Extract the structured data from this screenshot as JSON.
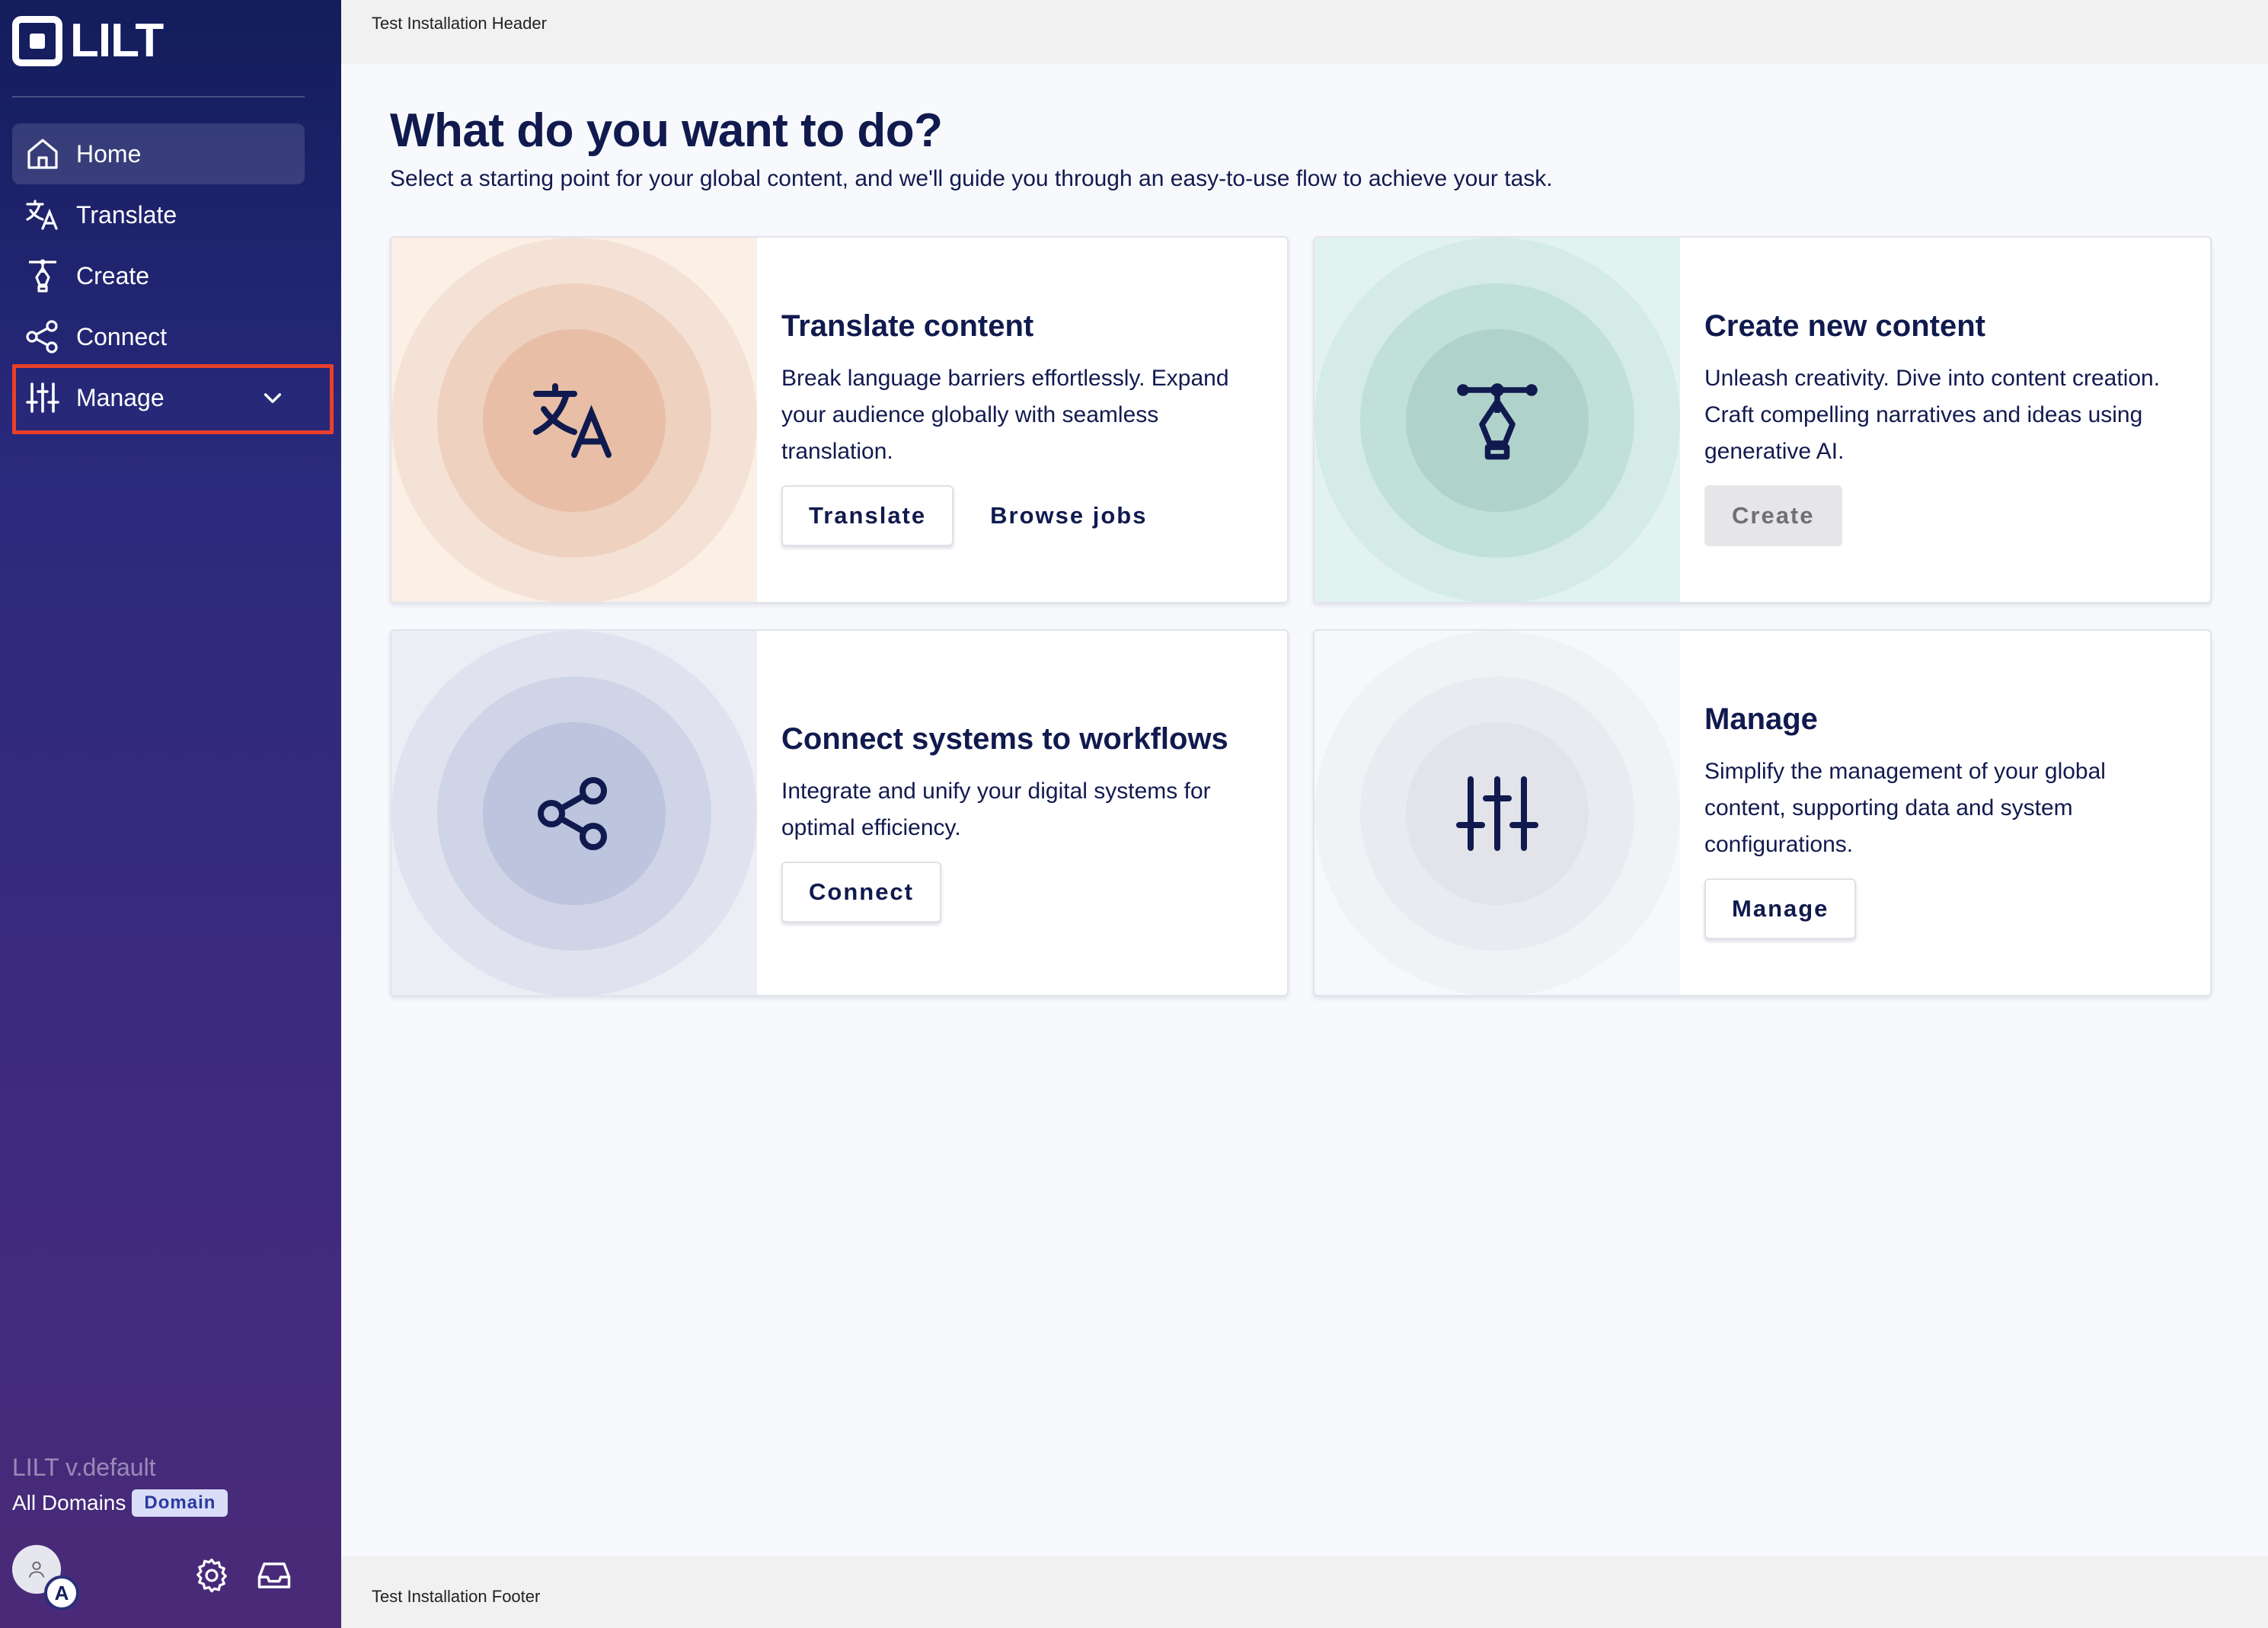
{
  "app": {
    "logo_text": "LILT"
  },
  "header": {
    "text": "Test Installation Header"
  },
  "footer": {
    "text": "Test Installation Footer"
  },
  "sidebar": {
    "items": [
      {
        "label": "Home",
        "icon": "home-icon",
        "active": true
      },
      {
        "label": "Translate",
        "icon": "translate-icon"
      },
      {
        "label": "Create",
        "icon": "pen-nib-icon"
      },
      {
        "label": "Connect",
        "icon": "share-nodes-icon"
      },
      {
        "label": "Manage",
        "icon": "sliders-icon",
        "expandable": true
      }
    ],
    "version": "LILT v.default",
    "domains_label": "All Domains",
    "domain_badge": "Domain",
    "avatar_initial": "A"
  },
  "main": {
    "title": "What do you want to do?",
    "subtitle": "Select a starting point for your global content, and we'll guide you through an easy-to-use flow to achieve your task.",
    "cards": [
      {
        "title": "Translate content",
        "description": "Break language barriers effortlessly. Expand your audience globally with seamless translation.",
        "primary": "Translate",
        "secondary": "Browse jobs",
        "icon": "translate-icon",
        "colors": [
          "#fbefe6",
          "#f5e2d6",
          "#efd1c0",
          "#e8bfa6"
        ]
      },
      {
        "title": "Create new content",
        "description": "Unleash creativity. Dive into content creation. Craft compelling narratives and ideas using generative AI.",
        "primary": "Create",
        "primary_disabled": true,
        "icon": "pen-nib-icon",
        "colors": [
          "#e2f3ef",
          "#d4ebe6",
          "#c1e0d9",
          "#afd3ca"
        ]
      },
      {
        "title": "Connect systems to workflows",
        "description": "Integrate and unify your digital systems for optimal efficiency.",
        "primary": "Connect",
        "icon": "share-nodes-icon",
        "colors": [
          "#eceef5",
          "#e0e3ef",
          "#cfd4e7",
          "#bcc4de"
        ]
      },
      {
        "title": "Manage",
        "description": "Simplify the management of your global content, supporting data and system configurations.",
        "primary": "Manage",
        "icon": "sliders-icon",
        "colors": [
          "#f7f8fb",
          "#f1f2f6",
          "#e9ebf0",
          "#e2e4ea"
        ]
      }
    ]
  },
  "colors": {
    "accent": "#101a4e",
    "highlight": "#e8402a",
    "sidebar_top": "#131d5c",
    "sidebar_bottom": "#4a2a78"
  }
}
